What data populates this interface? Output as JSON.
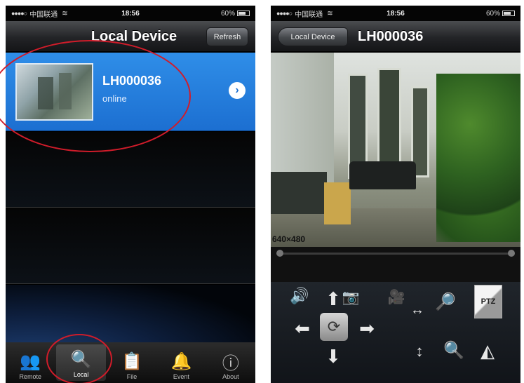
{
  "left_screen": {
    "status_bar": {
      "signal": "●●●●○",
      "carrier": "中国联通",
      "wifi": "WiFi",
      "time": "18:56",
      "battery": "60%"
    },
    "navbar": {
      "title": "Local Device",
      "refresh_label": "Refresh"
    },
    "devices": [
      {
        "name": "LH000036",
        "status": "online"
      }
    ],
    "tabs": [
      {
        "label": "Remote",
        "icon": "users-icon"
      },
      {
        "label": "Local",
        "icon": "search-icon",
        "active": true
      },
      {
        "label": "File",
        "icon": "clipboard-icon"
      },
      {
        "label": "Event",
        "icon": "bell-icon"
      },
      {
        "label": "About",
        "icon": "info-icon"
      }
    ]
  },
  "right_screen": {
    "status_bar": {
      "signal": "●●●●○",
      "carrier": "中国联通",
      "wifi": "WiFi",
      "time": "18:56",
      "battery": "60%"
    },
    "navbar": {
      "back_label": "Local Device",
      "title": "LH000036"
    },
    "video": {
      "resolution": "640×480"
    },
    "controls": {
      "ptz_label": "PTZ"
    }
  },
  "colors": {
    "accent_blue": "#1c6fd1",
    "highlight_red": "#d01c2a"
  }
}
